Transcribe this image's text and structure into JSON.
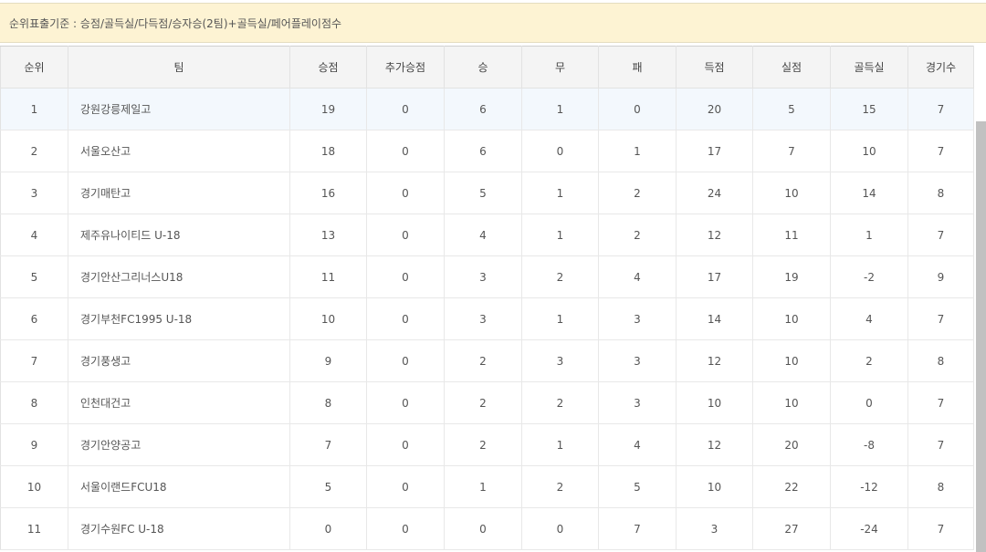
{
  "notice": "순위표출기준 : 승점/골득실/다득점/승자승(2팀)+골득실/페어플레이점수",
  "columns": [
    "순위",
    "팀",
    "승점",
    "추가승점",
    "승",
    "무",
    "패",
    "득점",
    "실점",
    "골득실",
    "경기수"
  ],
  "rows": [
    {
      "rank": "1",
      "team": "강원강릉제일고",
      "pts": "19",
      "bonus": "0",
      "w": "6",
      "d": "1",
      "l": "0",
      "gf": "20",
      "ga": "5",
      "gd": "15",
      "gp": "7"
    },
    {
      "rank": "2",
      "team": "서울오산고",
      "pts": "18",
      "bonus": "0",
      "w": "6",
      "d": "0",
      "l": "1",
      "gf": "17",
      "ga": "7",
      "gd": "10",
      "gp": "7"
    },
    {
      "rank": "3",
      "team": "경기매탄고",
      "pts": "16",
      "bonus": "0",
      "w": "5",
      "d": "1",
      "l": "2",
      "gf": "24",
      "ga": "10",
      "gd": "14",
      "gp": "8"
    },
    {
      "rank": "4",
      "team": "제주유나이티드 U-18",
      "pts": "13",
      "bonus": "0",
      "w": "4",
      "d": "1",
      "l": "2",
      "gf": "12",
      "ga": "11",
      "gd": "1",
      "gp": "7"
    },
    {
      "rank": "5",
      "team": "경기안산그리너스U18",
      "pts": "11",
      "bonus": "0",
      "w": "3",
      "d": "2",
      "l": "4",
      "gf": "17",
      "ga": "19",
      "gd": "-2",
      "gp": "9"
    },
    {
      "rank": "6",
      "team": "경기부천FC1995 U-18",
      "pts": "10",
      "bonus": "0",
      "w": "3",
      "d": "1",
      "l": "3",
      "gf": "14",
      "ga": "10",
      "gd": "4",
      "gp": "7"
    },
    {
      "rank": "7",
      "team": "경기풍생고",
      "pts": "9",
      "bonus": "0",
      "w": "2",
      "d": "3",
      "l": "3",
      "gf": "12",
      "ga": "10",
      "gd": "2",
      "gp": "8"
    },
    {
      "rank": "8",
      "team": "인천대건고",
      "pts": "8",
      "bonus": "0",
      "w": "2",
      "d": "2",
      "l": "3",
      "gf": "10",
      "ga": "10",
      "gd": "0",
      "gp": "7"
    },
    {
      "rank": "9",
      "team": "경기안양공고",
      "pts": "7",
      "bonus": "0",
      "w": "2",
      "d": "1",
      "l": "4",
      "gf": "12",
      "ga": "20",
      "gd": "-8",
      "gp": "7"
    },
    {
      "rank": "10",
      "team": "서울이랜드FCU18",
      "pts": "5",
      "bonus": "0",
      "w": "1",
      "d": "2",
      "l": "5",
      "gf": "10",
      "ga": "22",
      "gd": "-12",
      "gp": "8"
    },
    {
      "rank": "11",
      "team": "경기수원FC U-18",
      "pts": "0",
      "bonus": "0",
      "w": "0",
      "d": "0",
      "l": "7",
      "gf": "3",
      "ga": "27",
      "gd": "-24",
      "gp": "7"
    }
  ],
  "colors": {
    "notice_bg": "#fdf3d3",
    "header_bg": "#f4f4f4",
    "highlight_row": "#f3f8fd",
    "scrollbar": "#c1c1c1"
  }
}
